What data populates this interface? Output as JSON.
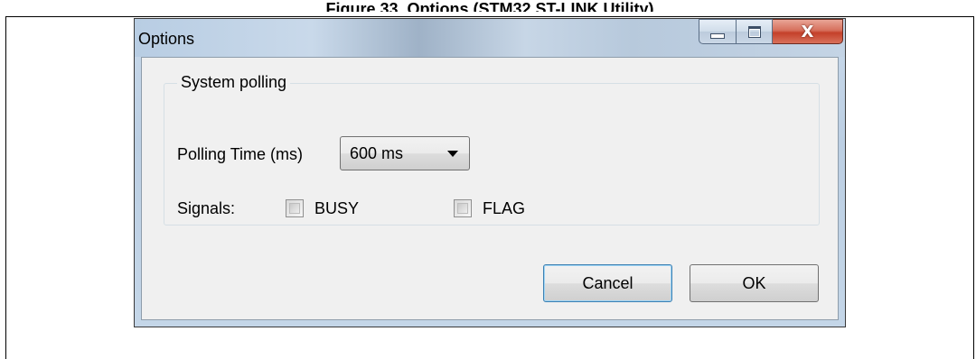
{
  "document": {
    "caption": "Figure 33. Options (STM32 ST-LINK Utility)"
  },
  "window": {
    "title": "Options",
    "controls": {
      "minimize_icon": "minimize-icon",
      "maximize_icon": "maximize-icon",
      "close_icon": "close-icon",
      "close_glyph": "X"
    }
  },
  "group": {
    "legend": "System polling",
    "polling_label": "Polling Time (ms)",
    "polling_value": "600 ms",
    "signals_label": "Signals:",
    "signals": [
      {
        "label": "BUSY",
        "checked": false
      },
      {
        "label": "FLAG",
        "checked": false
      }
    ]
  },
  "buttons": {
    "cancel": "Cancel",
    "ok": "OK"
  },
  "colors": {
    "title_bar": "#c4d4e5",
    "close_button": "#c4402a",
    "client_bg": "#f0f0f0",
    "default_button_border": "#3c7fb1"
  }
}
